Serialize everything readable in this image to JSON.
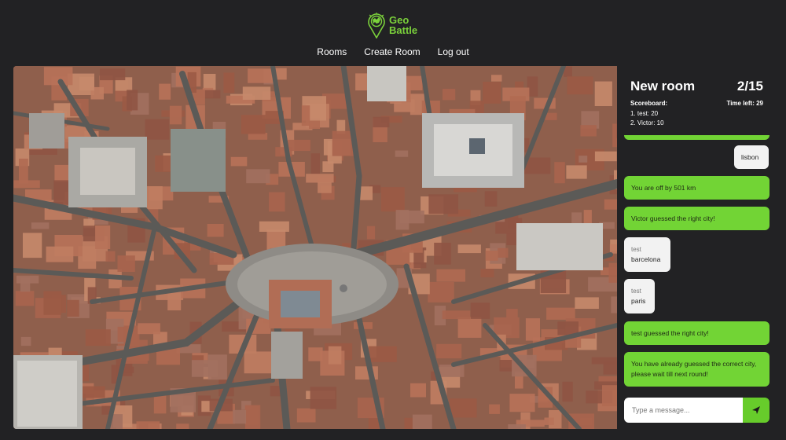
{
  "app": {
    "logo_line1": "Geo",
    "logo_line2": "Battle",
    "accent_color": "#7bd13b"
  },
  "nav": {
    "items": [
      {
        "label": "Rooms"
      },
      {
        "label": "Create Room"
      },
      {
        "label": "Log out"
      }
    ]
  },
  "room": {
    "name": "New room",
    "round": "2/15",
    "scoreboard_title": "Scoreboard:",
    "time_left": "Time left: 29",
    "scores": [
      "1. test: 20",
      "2. Victor: 10"
    ]
  },
  "chat": {
    "messages": [
      {
        "type": "system",
        "text": ""
      },
      {
        "type": "own",
        "text": "lisbon"
      },
      {
        "type": "system",
        "text": "You are off by 501 km"
      },
      {
        "type": "system",
        "text": "Victor guessed the right city!"
      },
      {
        "type": "user",
        "author": "test",
        "text": "barcelona"
      },
      {
        "type": "user",
        "author": "test",
        "text": "paris"
      },
      {
        "type": "system",
        "text": "test guessed the right city!"
      },
      {
        "type": "system",
        "text": "You have already guessed the correct city, please wait till next round!"
      }
    ],
    "input_placeholder": "Type a message...",
    "send_icon": "send-icon"
  },
  "map": {
    "description_icon": "satellite-map"
  }
}
